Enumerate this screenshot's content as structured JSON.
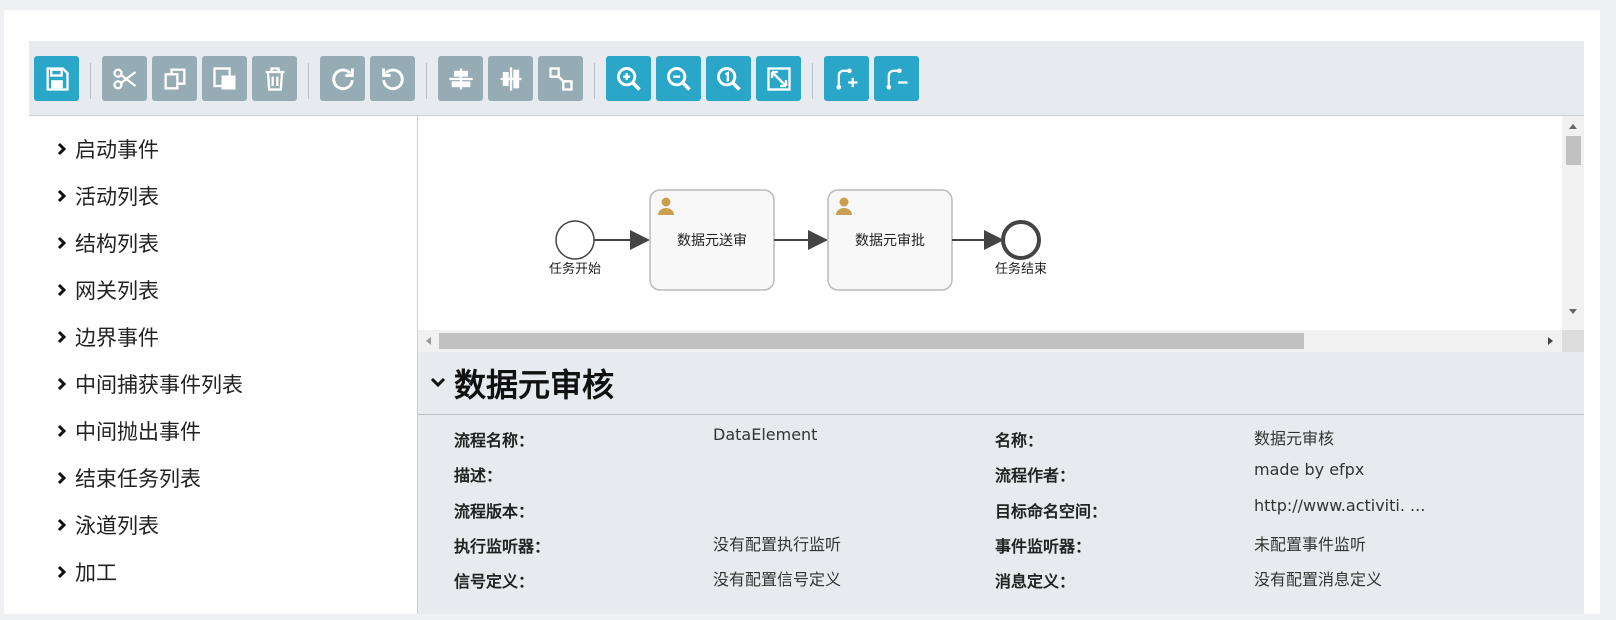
{
  "toolbar": {
    "buttons": [
      {
        "name": "save-icon",
        "color": "blue"
      },
      {
        "name": "cut-icon",
        "color": "gray"
      },
      {
        "name": "copy-icon",
        "color": "gray"
      },
      {
        "name": "paste-icon",
        "color": "gray"
      },
      {
        "name": "delete-icon",
        "color": "gray"
      },
      {
        "name": "redo-icon",
        "color": "gray"
      },
      {
        "name": "undo-icon",
        "color": "gray"
      },
      {
        "name": "align-vertical-icon",
        "color": "gray"
      },
      {
        "name": "align-horizontal-icon",
        "color": "gray"
      },
      {
        "name": "same-size-icon",
        "color": "gray"
      },
      {
        "name": "zoom-in-icon",
        "color": "blue"
      },
      {
        "name": "zoom-out-icon",
        "color": "blue"
      },
      {
        "name": "zoom-actual-icon",
        "color": "blue"
      },
      {
        "name": "zoom-fit-icon",
        "color": "blue"
      },
      {
        "name": "add-bendpoint-icon",
        "color": "blue"
      },
      {
        "name": "remove-bendpoint-icon",
        "color": "blue"
      }
    ],
    "colors": {
      "blue": "#2aa6c9",
      "gray": "#95acb4",
      "background": "#e7ebef"
    }
  },
  "sidebar": {
    "items": [
      {
        "label": "启动事件"
      },
      {
        "label": "活动列表"
      },
      {
        "label": "结构列表"
      },
      {
        "label": "网关列表"
      },
      {
        "label": "边界事件"
      },
      {
        "label": "中间捕获事件列表"
      },
      {
        "label": "中间抛出事件"
      },
      {
        "label": "结束任务列表"
      },
      {
        "label": "泳道列表"
      },
      {
        "label": "加工"
      }
    ]
  },
  "diagram": {
    "start_event_label": "任务开始",
    "task1_label": "数据元送审",
    "task2_label": "数据元审批",
    "end_event_label": "任务结束"
  },
  "properties": {
    "title": "数据元审核",
    "rows": [
      {
        "label1": "流程名称：",
        "value1": "DataElement",
        "label2": "名称：",
        "value2": "数据元审核"
      },
      {
        "label1": "描述：",
        "value1": "",
        "label2": "流程作者：",
        "value2": "made by efpx"
      },
      {
        "label1": "流程版本：",
        "value1": "",
        "label2": "目标命名空间：",
        "value2": "http://www.activiti. ..."
      },
      {
        "label1": "执行监听器：",
        "value1": "没有配置执行监听",
        "label2": "事件监听器：",
        "value2": "未配置事件监听"
      },
      {
        "label1": "信号定义：",
        "value1": "没有配置信号定义",
        "label2": "消息定义：",
        "value2": "没有配置消息定义"
      }
    ]
  }
}
